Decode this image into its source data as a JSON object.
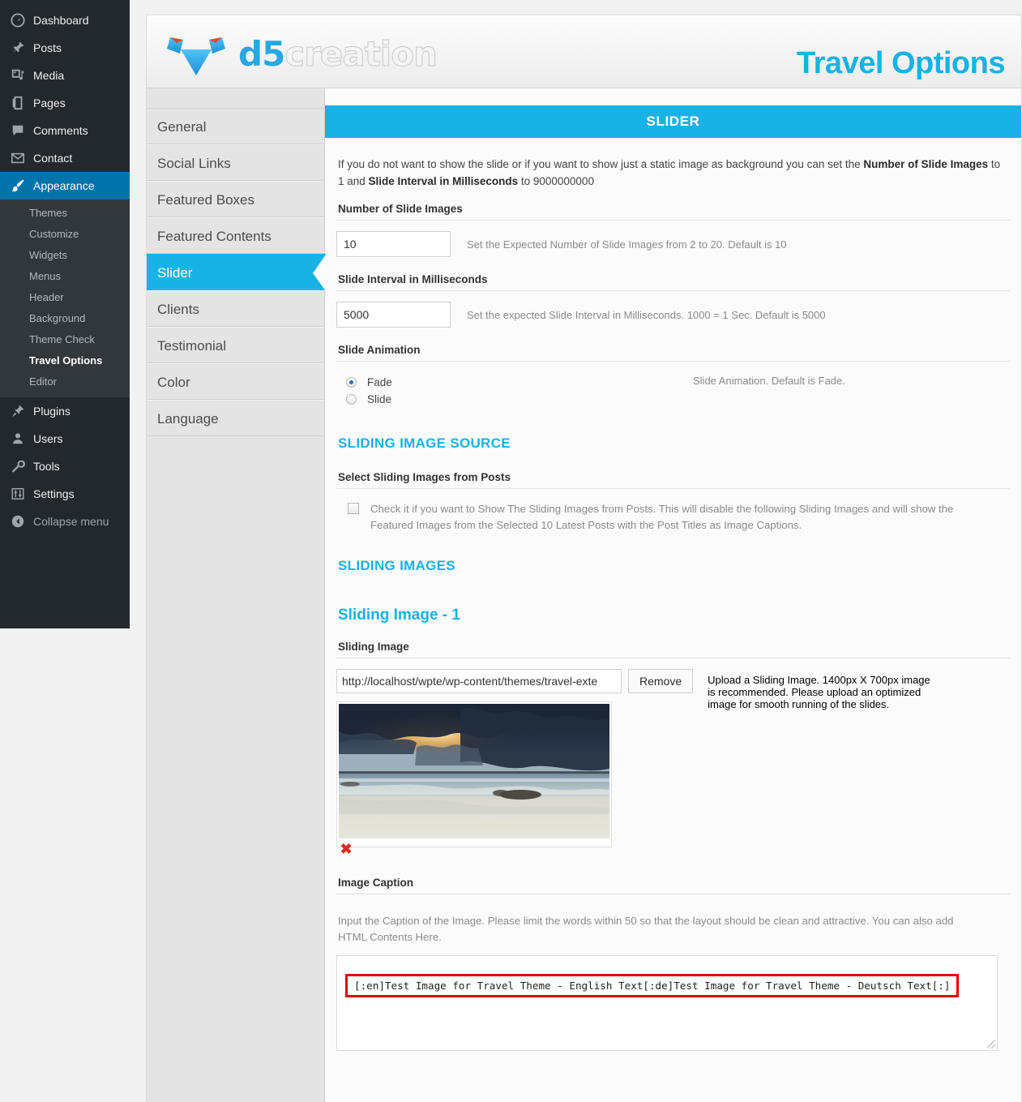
{
  "admin_menu": {
    "items": [
      {
        "label": "Dashboard",
        "icon": "dashboard-icon",
        "current": false
      },
      {
        "label": "Posts",
        "icon": "pin-icon",
        "current": false
      },
      {
        "label": "Media",
        "icon": "media-icon",
        "current": false
      },
      {
        "label": "Pages",
        "icon": "pages-icon",
        "current": false
      },
      {
        "label": "Comments",
        "icon": "comments-icon",
        "current": false
      },
      {
        "label": "Contact",
        "icon": "mail-icon",
        "current": false
      },
      {
        "label": "Appearance",
        "icon": "brush-icon",
        "current": true
      }
    ],
    "appearance_submenu": [
      {
        "label": "Themes",
        "current": false
      },
      {
        "label": "Customize",
        "current": false
      },
      {
        "label": "Widgets",
        "current": false
      },
      {
        "label": "Menus",
        "current": false
      },
      {
        "label": "Header",
        "current": false
      },
      {
        "label": "Background",
        "current": false
      },
      {
        "label": "Theme Check",
        "current": false
      },
      {
        "label": "Travel Options",
        "current": true
      },
      {
        "label": "Editor",
        "current": false
      }
    ],
    "items_after": [
      {
        "label": "Plugins",
        "icon": "plug-icon"
      },
      {
        "label": "Users",
        "icon": "user-icon"
      },
      {
        "label": "Tools",
        "icon": "wrench-icon"
      },
      {
        "label": "Settings",
        "icon": "sliders-icon"
      }
    ],
    "collapse": {
      "label": "Collapse menu",
      "icon": "collapse-arrow-icon"
    }
  },
  "panel": {
    "logo_text_1": "d5",
    "logo_text_2": "creation",
    "title": "Travel Options",
    "accent_color": "#18b2e4"
  },
  "tabs": [
    {
      "label": "General",
      "active": false
    },
    {
      "label": "Social Links",
      "active": false
    },
    {
      "label": "Featured Boxes",
      "active": false
    },
    {
      "label": "Featured Contents",
      "active": false
    },
    {
      "label": "Slider",
      "active": true
    },
    {
      "label": "Clients",
      "active": false
    },
    {
      "label": "Testimonial",
      "active": false
    },
    {
      "label": "Color",
      "active": false
    },
    {
      "label": "Language",
      "active": false
    }
  ],
  "slider": {
    "section_title": "SLIDER",
    "intro_a": "If you do not want to show the slide or if you want to show just a static image as background you can set the ",
    "intro_b": "Number of Slide Images",
    "intro_c": " to 1 and ",
    "intro_d": "Slide Interval in Milliseconds",
    "intro_e": " to 9000000000",
    "num_images": {
      "label": "Number of Slide Images",
      "value": "10",
      "hint": "Set the Expected Number of Slide Images from 2 to 20. Default is 10"
    },
    "interval": {
      "label": "Slide Interval in Milliseconds",
      "value": "5000",
      "hint": "Set the expected Slide Interval in Milliseconds. 1000 = 1 Sec. Default is 5000"
    },
    "animation": {
      "label": "Slide Animation",
      "options": [
        {
          "label": "Fade",
          "selected": true
        },
        {
          "label": "Slide",
          "selected": false
        }
      ],
      "hint": "Slide Animation. Default is Fade."
    },
    "image_source_heading": "SLIDING IMAGE SOURCE",
    "from_posts": {
      "label": "Select Sliding Images from Posts",
      "checked": false,
      "text": "Check it if you want to Show The Sliding Images from Posts. This will disable the following Sliding Images and will show the Featured Images from the Selected 10 Latest Posts with the Post Titles as Image Captions."
    },
    "sliding_images_heading": "SLIDING IMAGES",
    "image_1": {
      "heading": "Sliding Image - 1",
      "field_label": "Sliding Image",
      "url_value": "http://localhost/wpte/wp-content/themes/travel-exte",
      "remove_label": "Remove",
      "upload_hint": "Upload a Sliding Image. 1400px X 700px image is recommended. Please upload an optimized image for smooth running of the slides.",
      "thumbnail_alt": "beach-sunset-storm-clouds-thumbnail",
      "delete_icon": "red-x-delete-icon",
      "caption_label": "Image Caption",
      "caption_hint": "Input the Caption of the Image. Please limit the words within 50 so that the layout should be clean and attractive. You can also add HTML Contents Here.",
      "caption_value": "[:en]Test Image for Travel Theme - English Text[:de]Test Image for Travel Theme - Deutsch Text[:]",
      "highlight_color": "#e60000"
    }
  }
}
